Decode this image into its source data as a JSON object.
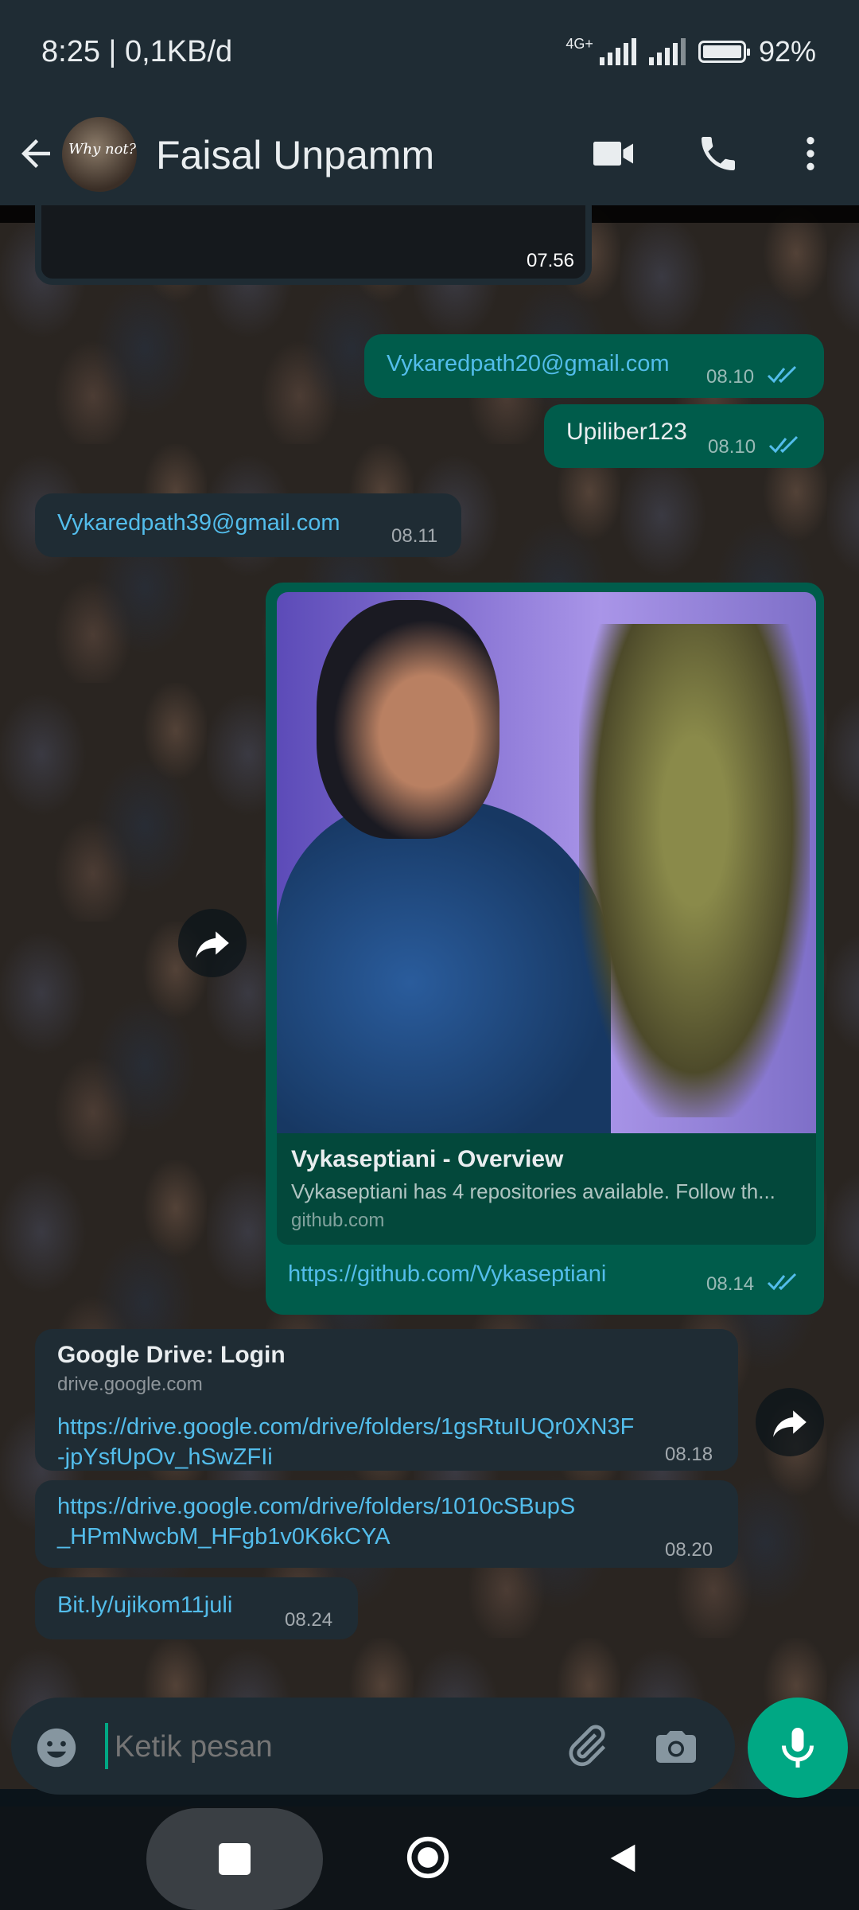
{
  "status_bar": {
    "time": "8:25 | 0,1KB/d",
    "network": "4G+",
    "battery": "92%"
  },
  "header": {
    "contact_name": "Faisal Unpamm",
    "avatar_text": "Why not?"
  },
  "messages": [
    {
      "id": "m0",
      "type": "out-media",
      "time": "07.56"
    },
    {
      "id": "m1",
      "type": "out",
      "text": "Vykaredpath20@gmail.com",
      "time": "08.10",
      "status": "read"
    },
    {
      "id": "m2",
      "type": "out",
      "text": "Upiliber123",
      "time": "08.10",
      "status": "read"
    },
    {
      "id": "m3",
      "type": "in",
      "text": "Vykaredpath39@gmail.com",
      "time": "08.11"
    },
    {
      "id": "m4",
      "type": "out-link-preview",
      "preview_title": "Vykaseptiani - Overview",
      "preview_desc": "Vykaseptiani has 4 repositories available. Follow th...",
      "preview_domain": "github.com",
      "text": "https://github.com/Vykaseptiani",
      "time": "08.14",
      "status": "read"
    },
    {
      "id": "m5",
      "type": "in-link-preview",
      "preview_title": "Google Drive: Login",
      "preview_domain": "drive.google.com",
      "text_line1": "https://drive.google.com/drive/folders/1gsRtuIUQr0XN3F",
      "text_line2": "-jpYsfUpOv_hSwZFIi",
      "time": "08.18"
    },
    {
      "id": "m6",
      "type": "in",
      "text_line1": "https://drive.google.com/drive/folders/1010cSBupS",
      "text_line2": "_HPmNwcbM_HFgb1v0K6kCYA",
      "time": "08.20"
    },
    {
      "id": "m7",
      "type": "in",
      "text": "Bit.ly/ujikom11juli",
      "time": "08.24"
    }
  ],
  "composer": {
    "placeholder": "Ketik pesan"
  },
  "icons": {
    "back": "arrow-left-icon",
    "video": "video-call-icon",
    "call": "phone-icon",
    "menu": "more-vert-icon",
    "emoji": "emoji-icon",
    "attach": "paperclip-icon",
    "camera": "camera-icon",
    "mic": "mic-icon",
    "forward": "forward-icon",
    "nav_recents": "square-icon",
    "nav_home": "circle-icon",
    "nav_back": "triangle-back-icon"
  },
  "colors": {
    "outgoing": "#005c4b",
    "incoming": "#1f2c34",
    "link": "#53bdeb",
    "accent": "#00a884",
    "tick_read": "#53bdeb"
  }
}
